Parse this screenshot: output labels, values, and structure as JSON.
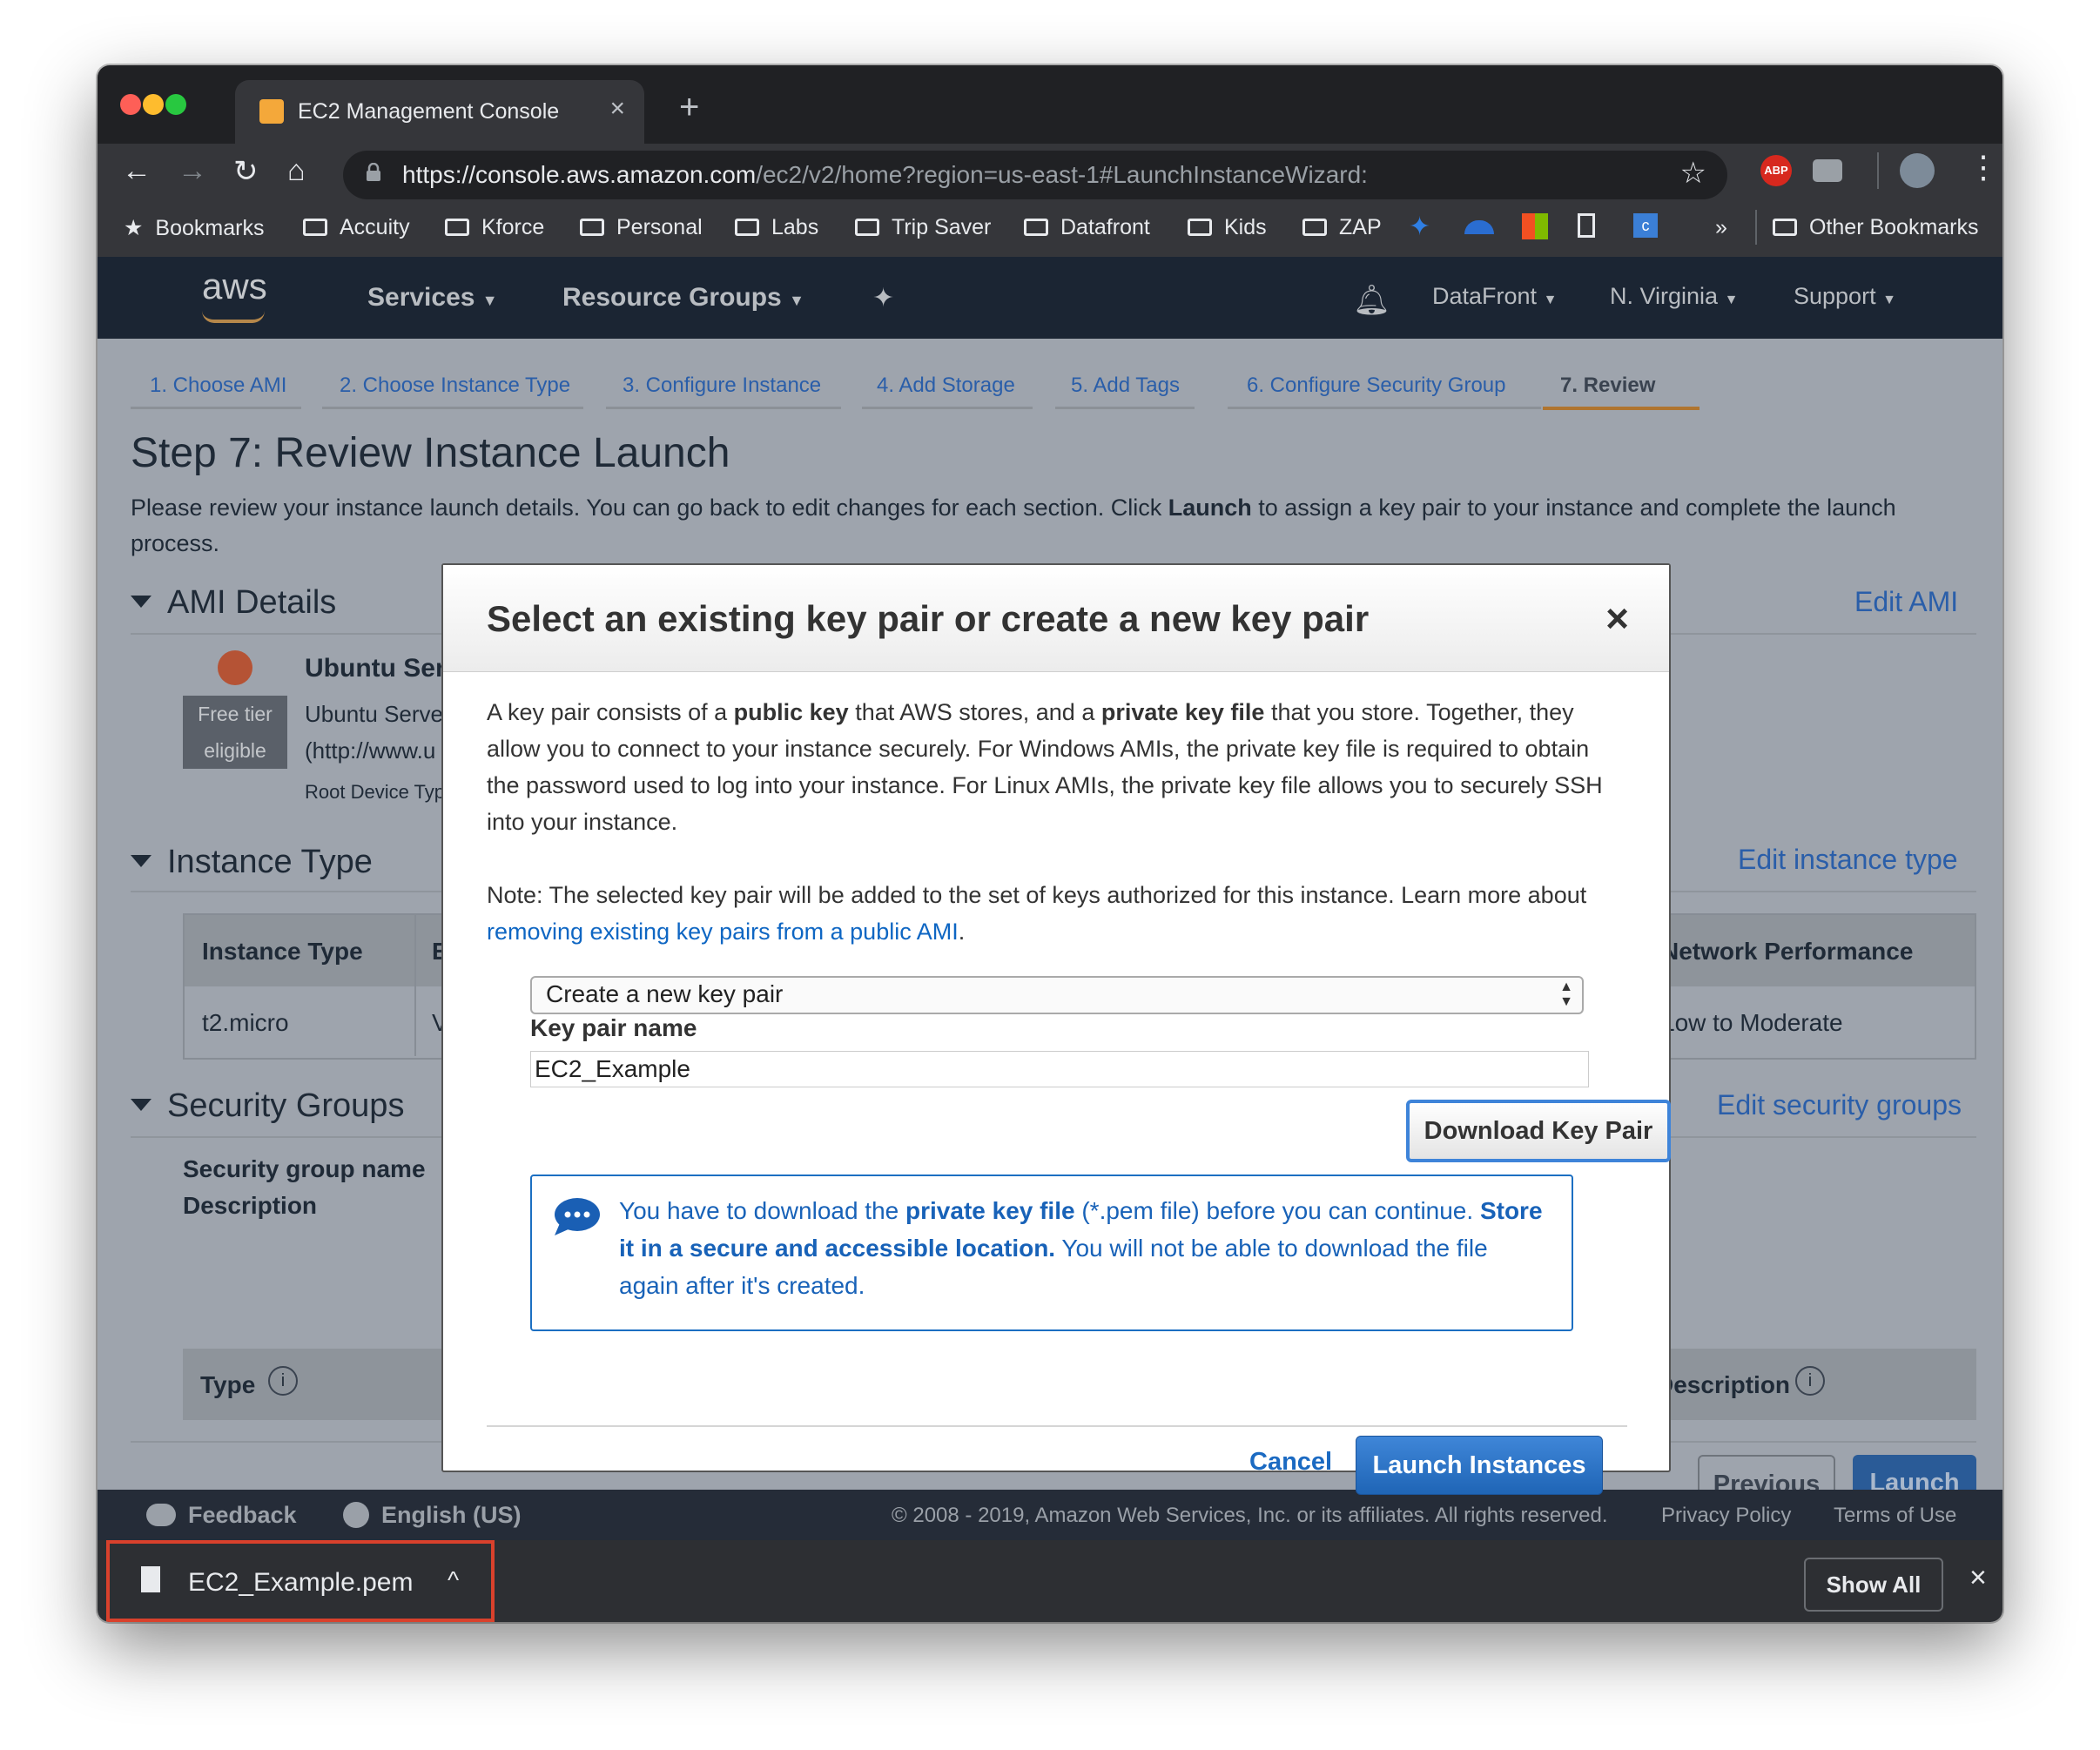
{
  "browser": {
    "tab_title": "EC2 Management Console",
    "new_tab": "+",
    "tab_close": "×",
    "url_host": "https://console.aws.amazon.com",
    "url_path": "/ec2/v2/home?region=us-east-1#LaunchInstanceWizard:",
    "bookmarks": [
      "Bookmarks",
      "Accuity",
      "Kforce",
      "Personal",
      "Labs",
      "Trip Saver",
      "Datafront",
      "Kids",
      "ZAP"
    ],
    "bookmarks_more": "»",
    "other_bookmarks": "Other Bookmarks",
    "ext_abp": "ABP"
  },
  "aws_nav": {
    "logo": "aws",
    "services": "Services",
    "resource_groups": "Resource Groups",
    "account": "DataFront",
    "region": "N. Virginia",
    "support": "Support"
  },
  "wizard_tabs": [
    "1. Choose AMI",
    "2. Choose Instance Type",
    "3. Configure Instance",
    "4. Add Storage",
    "5. Add Tags",
    "6. Configure Security Group",
    "7. Review"
  ],
  "page": {
    "title": "Step 7: Review Instance Launch",
    "desc_pre": "Please review your instance launch details. You can go back to edit changes for each section. Click ",
    "desc_bold": "Launch",
    "desc_post": " to assign a key pair to your instance and complete the launch process.",
    "ami_section": "AMI Details",
    "edit_ami": "Edit AMI",
    "ami_name": "Ubuntu Ser",
    "ami_desc1": "Ubuntu Serve",
    "ami_desc2": "(http://www.u",
    "root_device": "Root Device Typ",
    "free_tier1": "Free tier",
    "free_tier2": "eligible",
    "instance_section": "Instance Type",
    "edit_instance": "Edit instance type",
    "col_instance_type": "Instance Type",
    "col_e": "E",
    "col_network": "Network Performance",
    "cell_type": "t2.micro",
    "cell_v": "V",
    "cell_network": "Low to Moderate",
    "security_section": "Security Groups",
    "edit_security": "Edit security groups",
    "sg_name_label": "Security group name",
    "sg_desc_label": "Description",
    "sg_col_type": "Type",
    "sg_col_desc": "Description",
    "previous": "Previous",
    "launch": "Launch"
  },
  "footer": {
    "feedback": "Feedback",
    "language": "English (US)",
    "copyright": "© 2008 - 2019, Amazon Web Services, Inc. or its affiliates. All rights reserved.",
    "privacy": "Privacy Policy",
    "terms": "Terms of Use"
  },
  "downloads": {
    "file": "EC2_Example.pem",
    "show_all": "Show All",
    "close": "×"
  },
  "modal": {
    "title": "Select an existing key pair or create a new key pair",
    "close": "×",
    "p1_a": "A key pair consists of a ",
    "p1_b": "public key",
    "p1_c": " that AWS stores, and a ",
    "p1_d": "private key file",
    "p1_e": " that you store. Together, they allow you to connect to your instance securely. For Windows AMIs, the private key file is required to obtain the password used to log into your instance. For Linux AMIs, the private key file allows you to securely SSH into your instance.",
    "note_a": "Note: The selected key pair will be added to the set of keys authorized for this instance. Learn more about ",
    "note_link": "removing existing key pairs from a public AMI",
    "note_b": ".",
    "select_value": "Create a new key pair",
    "key_label": "Key pair name",
    "key_value": "EC2_Example",
    "download_button": "Download Key Pair",
    "info_a": "You have to download the ",
    "info_b": "private key file",
    "info_c": " (*.pem file) before you can continue. ",
    "info_d": "Store it in a secure and accessible location.",
    "info_e": " You will not be able to download the file again after it's created.",
    "cancel": "Cancel",
    "launch_instances": "Launch Instances"
  }
}
